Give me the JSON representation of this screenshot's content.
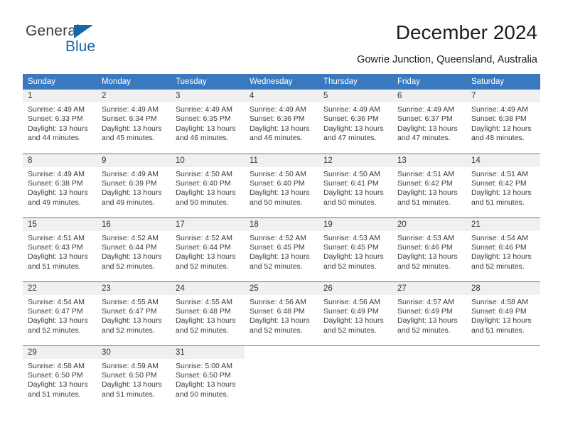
{
  "brand": {
    "name_top": "General",
    "name_bottom": "Blue",
    "triangle_icon": "triangle-icon",
    "color_primary": "#1565a8",
    "color_text": "#3a3a3a"
  },
  "header": {
    "title": "December 2024",
    "location": "Gowrie Junction, Queensland, Australia"
  },
  "theme": {
    "header_blue": "#3b79bf",
    "daynum_bg": "#f0f0f0",
    "text": "#3b3b3b"
  },
  "weekday_headers": [
    "Sunday",
    "Monday",
    "Tuesday",
    "Wednesday",
    "Thursday",
    "Friday",
    "Saturday"
  ],
  "labels": {
    "sunrise_prefix": "Sunrise:",
    "sunset_prefix": "Sunset:",
    "daylight_prefix": "Daylight:"
  },
  "weeks": [
    [
      {
        "day": "1",
        "sunrise": "Sunrise: 4:49 AM",
        "sunset": "Sunset: 6:33 PM",
        "daylight": "Daylight: 13 hours and 44 minutes."
      },
      {
        "day": "2",
        "sunrise": "Sunrise: 4:49 AM",
        "sunset": "Sunset: 6:34 PM",
        "daylight": "Daylight: 13 hours and 45 minutes."
      },
      {
        "day": "3",
        "sunrise": "Sunrise: 4:49 AM",
        "sunset": "Sunset: 6:35 PM",
        "daylight": "Daylight: 13 hours and 46 minutes."
      },
      {
        "day": "4",
        "sunrise": "Sunrise: 4:49 AM",
        "sunset": "Sunset: 6:36 PM",
        "daylight": "Daylight: 13 hours and 46 minutes."
      },
      {
        "day": "5",
        "sunrise": "Sunrise: 4:49 AM",
        "sunset": "Sunset: 6:36 PM",
        "daylight": "Daylight: 13 hours and 47 minutes."
      },
      {
        "day": "6",
        "sunrise": "Sunrise: 4:49 AM",
        "sunset": "Sunset: 6:37 PM",
        "daylight": "Daylight: 13 hours and 47 minutes."
      },
      {
        "day": "7",
        "sunrise": "Sunrise: 4:49 AM",
        "sunset": "Sunset: 6:38 PM",
        "daylight": "Daylight: 13 hours and 48 minutes."
      }
    ],
    [
      {
        "day": "8",
        "sunrise": "Sunrise: 4:49 AM",
        "sunset": "Sunset: 6:38 PM",
        "daylight": "Daylight: 13 hours and 49 minutes."
      },
      {
        "day": "9",
        "sunrise": "Sunrise: 4:49 AM",
        "sunset": "Sunset: 6:39 PM",
        "daylight": "Daylight: 13 hours and 49 minutes."
      },
      {
        "day": "10",
        "sunrise": "Sunrise: 4:50 AM",
        "sunset": "Sunset: 6:40 PM",
        "daylight": "Daylight: 13 hours and 50 minutes."
      },
      {
        "day": "11",
        "sunrise": "Sunrise: 4:50 AM",
        "sunset": "Sunset: 6:40 PM",
        "daylight": "Daylight: 13 hours and 50 minutes."
      },
      {
        "day": "12",
        "sunrise": "Sunrise: 4:50 AM",
        "sunset": "Sunset: 6:41 PM",
        "daylight": "Daylight: 13 hours and 50 minutes."
      },
      {
        "day": "13",
        "sunrise": "Sunrise: 4:51 AM",
        "sunset": "Sunset: 6:42 PM",
        "daylight": "Daylight: 13 hours and 51 minutes."
      },
      {
        "day": "14",
        "sunrise": "Sunrise: 4:51 AM",
        "sunset": "Sunset: 6:42 PM",
        "daylight": "Daylight: 13 hours and 51 minutes."
      }
    ],
    [
      {
        "day": "15",
        "sunrise": "Sunrise: 4:51 AM",
        "sunset": "Sunset: 6:43 PM",
        "daylight": "Daylight: 13 hours and 51 minutes."
      },
      {
        "day": "16",
        "sunrise": "Sunrise: 4:52 AM",
        "sunset": "Sunset: 6:44 PM",
        "daylight": "Daylight: 13 hours and 52 minutes."
      },
      {
        "day": "17",
        "sunrise": "Sunrise: 4:52 AM",
        "sunset": "Sunset: 6:44 PM",
        "daylight": "Daylight: 13 hours and 52 minutes."
      },
      {
        "day": "18",
        "sunrise": "Sunrise: 4:52 AM",
        "sunset": "Sunset: 6:45 PM",
        "daylight": "Daylight: 13 hours and 52 minutes."
      },
      {
        "day": "19",
        "sunrise": "Sunrise: 4:53 AM",
        "sunset": "Sunset: 6:45 PM",
        "daylight": "Daylight: 13 hours and 52 minutes."
      },
      {
        "day": "20",
        "sunrise": "Sunrise: 4:53 AM",
        "sunset": "Sunset: 6:46 PM",
        "daylight": "Daylight: 13 hours and 52 minutes."
      },
      {
        "day": "21",
        "sunrise": "Sunrise: 4:54 AM",
        "sunset": "Sunset: 6:46 PM",
        "daylight": "Daylight: 13 hours and 52 minutes."
      }
    ],
    [
      {
        "day": "22",
        "sunrise": "Sunrise: 4:54 AM",
        "sunset": "Sunset: 6:47 PM",
        "daylight": "Daylight: 13 hours and 52 minutes."
      },
      {
        "day": "23",
        "sunrise": "Sunrise: 4:55 AM",
        "sunset": "Sunset: 6:47 PM",
        "daylight": "Daylight: 13 hours and 52 minutes."
      },
      {
        "day": "24",
        "sunrise": "Sunrise: 4:55 AM",
        "sunset": "Sunset: 6:48 PM",
        "daylight": "Daylight: 13 hours and 52 minutes."
      },
      {
        "day": "25",
        "sunrise": "Sunrise: 4:56 AM",
        "sunset": "Sunset: 6:48 PM",
        "daylight": "Daylight: 13 hours and 52 minutes."
      },
      {
        "day": "26",
        "sunrise": "Sunrise: 4:56 AM",
        "sunset": "Sunset: 6:49 PM",
        "daylight": "Daylight: 13 hours and 52 minutes."
      },
      {
        "day": "27",
        "sunrise": "Sunrise: 4:57 AM",
        "sunset": "Sunset: 6:49 PM",
        "daylight": "Daylight: 13 hours and 52 minutes."
      },
      {
        "day": "28",
        "sunrise": "Sunrise: 4:58 AM",
        "sunset": "Sunset: 6:49 PM",
        "daylight": "Daylight: 13 hours and 51 minutes."
      }
    ],
    [
      {
        "day": "29",
        "sunrise": "Sunrise: 4:58 AM",
        "sunset": "Sunset: 6:50 PM",
        "daylight": "Daylight: 13 hours and 51 minutes."
      },
      {
        "day": "30",
        "sunrise": "Sunrise: 4:59 AM",
        "sunset": "Sunset: 6:50 PM",
        "daylight": "Daylight: 13 hours and 51 minutes."
      },
      {
        "day": "31",
        "sunrise": "Sunrise: 5:00 AM",
        "sunset": "Sunset: 6:50 PM",
        "daylight": "Daylight: 13 hours and 50 minutes."
      },
      {
        "day": "",
        "sunrise": "",
        "sunset": "",
        "daylight": ""
      },
      {
        "day": "",
        "sunrise": "",
        "sunset": "",
        "daylight": ""
      },
      {
        "day": "",
        "sunrise": "",
        "sunset": "",
        "daylight": ""
      },
      {
        "day": "",
        "sunrise": "",
        "sunset": "",
        "daylight": ""
      }
    ]
  ]
}
